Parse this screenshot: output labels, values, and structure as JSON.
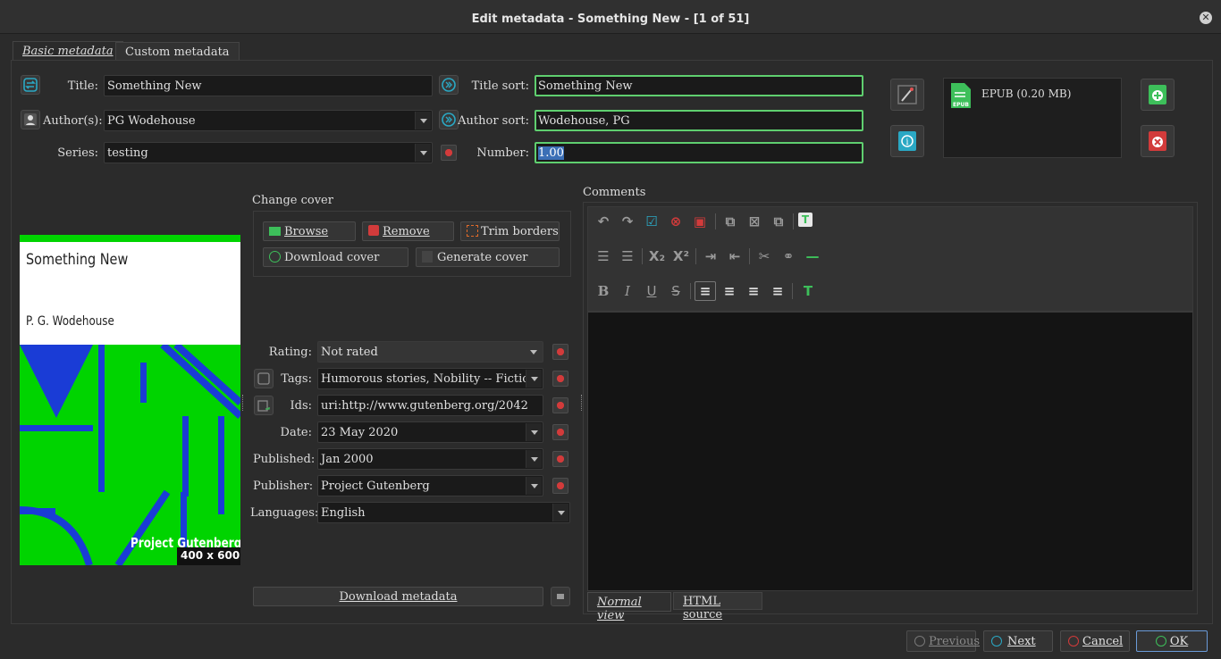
{
  "window": {
    "title": "Edit metadata - Something New -  [1 of 51]"
  },
  "tabs": [
    {
      "label": "Basic metadata"
    },
    {
      "label": "Custom metadata"
    }
  ],
  "fields": {
    "title_label": "Title:",
    "title_value": "Something New",
    "title_sort_label": "Title sort:",
    "title_sort_value": "Something New",
    "authors_label": "Author(s):",
    "authors_value": "PG Wodehouse",
    "author_sort_label": "Author sort:",
    "author_sort_value": "Wodehouse, PG",
    "series_label": "Series:",
    "series_value": "testing",
    "number_label": "Number:",
    "number_value": "1.00"
  },
  "format": {
    "label": "EPUB (0.20 MB)",
    "badge": "EPUB"
  },
  "cover": {
    "title": "Something New",
    "author": "P. G. Wodehouse",
    "publisher_text": "Project Gutenberg",
    "size": "400 x 600",
    "colors": {
      "green": "#00d400",
      "blue": "#1a3cd6"
    }
  },
  "change_cover": {
    "heading": "Change cover",
    "browse": "Browse",
    "remove": "Remove",
    "trim": "Trim borders",
    "download": "Download cover",
    "generate": "Generate cover"
  },
  "details": {
    "rating_label": "Rating:",
    "rating_value": "Not rated",
    "tags_label": "Tags:",
    "tags_value": "Humorous stories, Nobility -- Fiction, E",
    "ids_label": "Ids:",
    "ids_value": "uri:http://www.gutenberg.org/2042",
    "date_label": "Date:",
    "date_value": "23 May 2020",
    "published_label": "Published:",
    "published_value": "Jan 2000",
    "publisher_label": "Publisher:",
    "publisher_value": "Project Gutenberg",
    "languages_label": "Languages:",
    "languages_value": "English"
  },
  "download_metadata": "Download metadata",
  "comments": {
    "heading": "Comments",
    "normal_view": "Normal view",
    "html_source": "HTML source"
  },
  "footer": {
    "previous": "Previous",
    "next": "Next",
    "cancel": "Cancel",
    "ok": "OK"
  },
  "colors": {
    "accent_green": "#5fcf6f",
    "danger_red": "#d23b3b",
    "info_teal": "#2aa8c4"
  }
}
